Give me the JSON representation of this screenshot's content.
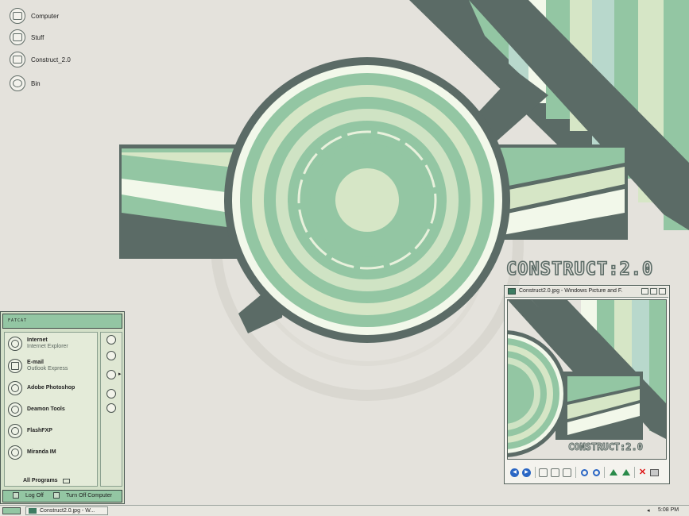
{
  "desktop_icons": [
    {
      "label": "Computer",
      "icon": "computer-icon"
    },
    {
      "label": "Stuff",
      "icon": "folder-icon"
    },
    {
      "label": "Construct_2.0",
      "icon": "folder-icon"
    },
    {
      "label": "Bin",
      "icon": "recycle-bin-icon"
    }
  ],
  "wallpaper": {
    "logo_text": "CONSTRUCT:2.0"
  },
  "start_menu": {
    "user": "FATCAT",
    "pinned": [
      {
        "name": "Internet",
        "sub": "Internet Explorer",
        "icon": "internet-icon"
      },
      {
        "name": "E-mail",
        "sub": "Outlook Express",
        "icon": "email-icon"
      }
    ],
    "programs": [
      {
        "name": "Adobe Photoshop",
        "icon": "photoshop-icon"
      },
      {
        "name": "Deamon Tools",
        "icon": "daemon-tools-icon"
      },
      {
        "name": "FlashFXP",
        "icon": "flashfxp-icon"
      },
      {
        "name": "Miranda IM",
        "icon": "miranda-icon"
      }
    ],
    "all_programs": "All Programs",
    "log_off": "Log Off",
    "turn_off": "Turn Off Computer"
  },
  "viewer": {
    "title": "Construct2.0.jpg - Windows Picture and F...",
    "image_logo": "CONSTRUCT:2.0"
  },
  "taskbar": {
    "task_label": "Construct2.0.jpg - W...",
    "clock": "5:08 PM"
  },
  "colors": {
    "mint": "#93c6a3",
    "pale_green": "#d6e6c6",
    "cream": "#f2f8ea",
    "dark_slate": "#5b6b66",
    "teal_pale": "#b8d8cc",
    "background": "#e4e2dc"
  }
}
